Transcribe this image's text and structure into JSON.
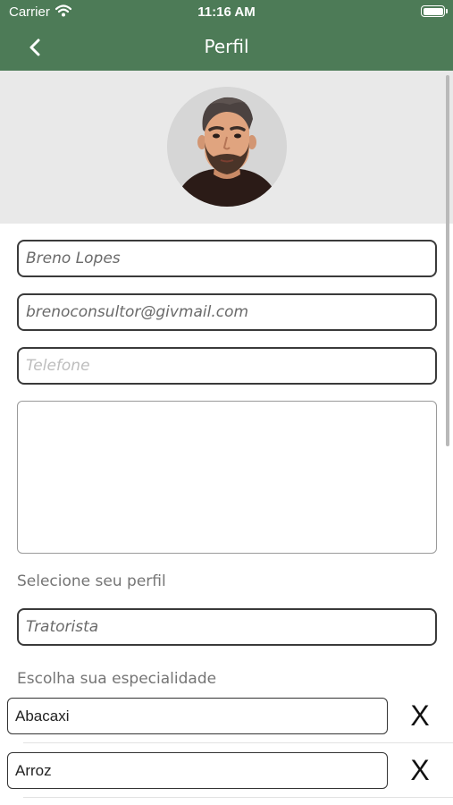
{
  "status_bar": {
    "carrier": "Carrier",
    "time": "11:16 AM"
  },
  "nav": {
    "title": "Perfil",
    "back_icon": "chevron-left-icon"
  },
  "profile": {
    "avatar": "user-avatar",
    "name_value": "Breno Lopes",
    "email_value": "brenoconsultor@givmail.com",
    "phone_placeholder": "Telefone",
    "bio_value": ""
  },
  "profile_type": {
    "label": "Selecione seu perfil",
    "selected": "Tratorista"
  },
  "specialties": {
    "label": "Escolha sua especialidade",
    "remove_label": "X",
    "items": [
      {
        "value": "Abacaxi"
      },
      {
        "value": "Arroz"
      }
    ]
  },
  "colors": {
    "header": "#4d7b57",
    "avatar_band": "#e9e9e9"
  }
}
